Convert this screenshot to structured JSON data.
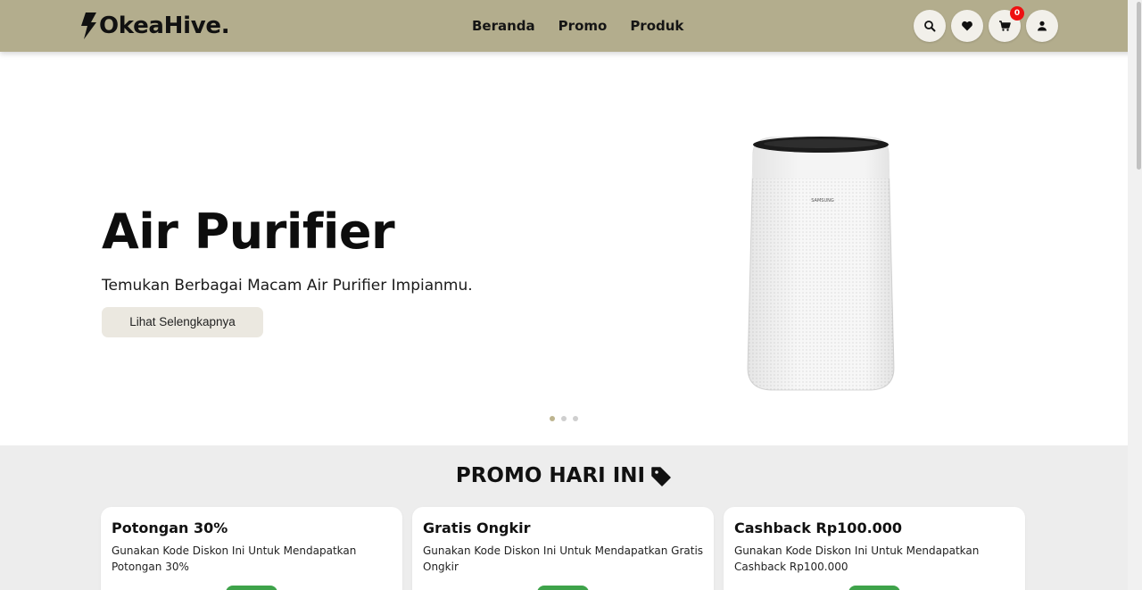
{
  "header": {
    "logo_text": "OkeaHive.",
    "nav": [
      "Beranda",
      "Promo",
      "Produk"
    ],
    "icons": [
      "search-icon",
      "heart-icon",
      "cart-icon",
      "user-icon"
    ],
    "cart_count": "0",
    "brand_color": "#b3ad8d"
  },
  "hero": {
    "title": "Air Purifier",
    "subtitle": "Temukan Berbagai Macam Air Purifier Impianmu.",
    "button_label": "Lihat Selengkapnya",
    "product_brand": "SAMSUNG",
    "slides_total": 3,
    "active_slide": 1
  },
  "promo": {
    "title": "PROMO HARI INI",
    "cards": [
      {
        "title": "Potongan 30%",
        "description": "Gunakan Kode Diskon Ini Untuk Mendapatkan Potongan 30%"
      },
      {
        "title": "Gratis Ongkir",
        "description": "Gunakan Kode Diskon Ini Untuk Mendapatkan Gratis Ongkir"
      },
      {
        "title": "Cashback Rp100.000",
        "description": "Gunakan Kode Diskon Ini Untuk Mendapatkan Cashback Rp100.000"
      }
    ],
    "button_color": "#3ea34a"
  }
}
